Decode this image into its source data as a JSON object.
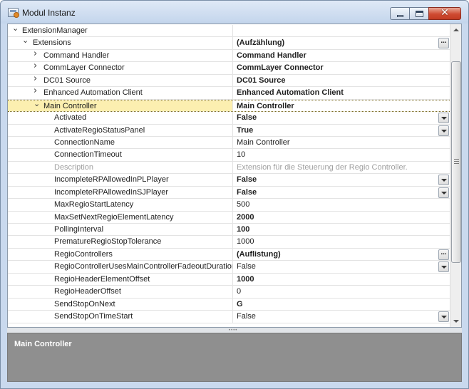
{
  "window": {
    "title": "Modul Instanz"
  },
  "grid": {
    "rows": [
      {
        "name": "ExtensionManager",
        "value": "",
        "level": 0,
        "expander": "expanded",
        "bold": false,
        "button": "none",
        "disabled": false,
        "selected": false
      },
      {
        "name": "Extensions",
        "value": "(Aufzählung)",
        "level": 1,
        "expander": "expanded",
        "bold": true,
        "button": "ellipsis",
        "disabled": false,
        "selected": false
      },
      {
        "name": "Command Handler",
        "value": "Command Handler",
        "level": 2,
        "expander": "collapsed",
        "bold": true,
        "button": "none",
        "disabled": false,
        "selected": false
      },
      {
        "name": "CommLayer Connector",
        "value": "CommLayer Connector",
        "level": 2,
        "expander": "collapsed",
        "bold": true,
        "button": "none",
        "disabled": false,
        "selected": false
      },
      {
        "name": "DC01 Source",
        "value": "DC01 Source",
        "level": 2,
        "expander": "collapsed",
        "bold": true,
        "button": "none",
        "disabled": false,
        "selected": false
      },
      {
        "name": "Enhanced Automation Client",
        "value": "Enhanced Automation Client",
        "level": 2,
        "expander": "collapsed",
        "bold": true,
        "button": "none",
        "disabled": false,
        "selected": false
      },
      {
        "name": "Main Controller",
        "value": "Main Controller",
        "level": 2,
        "expander": "expanded",
        "bold": true,
        "button": "none",
        "disabled": false,
        "selected": true
      },
      {
        "name": "Activated",
        "value": "False",
        "level": 3,
        "expander": "none",
        "bold": true,
        "button": "dropdown",
        "disabled": false,
        "selected": false
      },
      {
        "name": "ActivateRegioStatusPanel",
        "value": "True",
        "level": 3,
        "expander": "none",
        "bold": true,
        "button": "dropdown",
        "disabled": false,
        "selected": false
      },
      {
        "name": "ConnectionName",
        "value": "Main Controller",
        "level": 3,
        "expander": "none",
        "bold": false,
        "button": "none",
        "disabled": false,
        "selected": false
      },
      {
        "name": "ConnectionTimeout",
        "value": "10",
        "level": 3,
        "expander": "none",
        "bold": false,
        "button": "none",
        "disabled": false,
        "selected": false
      },
      {
        "name": "Description",
        "value": "Extension für die Steuerung der Regio Controller.",
        "level": 3,
        "expander": "none",
        "bold": false,
        "button": "none",
        "disabled": true,
        "selected": false
      },
      {
        "name": "IncompleteRPAllowedInPLPlayer",
        "value": "False",
        "level": 3,
        "expander": "none",
        "bold": true,
        "button": "dropdown",
        "disabled": false,
        "selected": false
      },
      {
        "name": "IncompleteRPAllowedInSJPlayer",
        "value": "False",
        "level": 3,
        "expander": "none",
        "bold": true,
        "button": "dropdown",
        "disabled": false,
        "selected": false
      },
      {
        "name": "MaxRegioStartLatency",
        "value": "500",
        "level": 3,
        "expander": "none",
        "bold": false,
        "button": "none",
        "disabled": false,
        "selected": false
      },
      {
        "name": "MaxSetNextRegioElementLatency",
        "value": "2000",
        "level": 3,
        "expander": "none",
        "bold": true,
        "button": "none",
        "disabled": false,
        "selected": false
      },
      {
        "name": "PollingInterval",
        "value": "100",
        "level": 3,
        "expander": "none",
        "bold": true,
        "button": "none",
        "disabled": false,
        "selected": false
      },
      {
        "name": "PrematureRegioStopTolerance",
        "value": "1000",
        "level": 3,
        "expander": "none",
        "bold": false,
        "button": "none",
        "disabled": false,
        "selected": false
      },
      {
        "name": "RegioControllers",
        "value": "(Auflistung)",
        "level": 3,
        "expander": "none",
        "bold": true,
        "button": "ellipsis",
        "disabled": false,
        "selected": false
      },
      {
        "name": "RegioControllerUsesMainControllerFadeoutDuration",
        "value": "False",
        "level": 3,
        "expander": "none",
        "bold": false,
        "button": "dropdown",
        "disabled": false,
        "selected": false
      },
      {
        "name": "RegioHeaderElementOffset",
        "value": "1000",
        "level": 3,
        "expander": "none",
        "bold": true,
        "button": "none",
        "disabled": false,
        "selected": false
      },
      {
        "name": "RegioHeaderOffset",
        "value": "0",
        "level": 3,
        "expander": "none",
        "bold": false,
        "button": "none",
        "disabled": false,
        "selected": false
      },
      {
        "name": "SendStopOnNext",
        "value": "G",
        "level": 3,
        "expander": "none",
        "bold": true,
        "button": "none",
        "disabled": false,
        "selected": false
      },
      {
        "name": "SendStopOnTimeStart",
        "value": "False",
        "level": 3,
        "expander": "none",
        "bold": false,
        "button": "dropdown",
        "disabled": false,
        "selected": false
      }
    ]
  },
  "description_panel": {
    "title": "Main Controller"
  }
}
